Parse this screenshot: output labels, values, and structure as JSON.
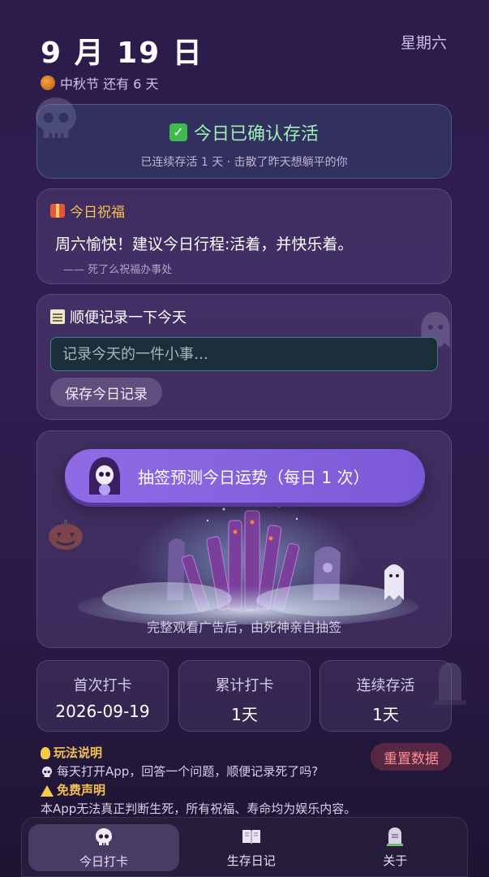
{
  "header": {
    "date": "9 月 19 日",
    "weekday": "星期六",
    "festival": "中秋节 还有 6 天"
  },
  "confirm": {
    "title": "今日已确认存活",
    "subtitle": "已连续存活 1 天 · 击散了昨天想躺平的你"
  },
  "blessing": {
    "heading": "今日祝福",
    "text": "周六愉快！建议今日行程:活着，并快乐着。",
    "signature": "—— 死了么祝福办事处"
  },
  "record": {
    "heading": "顺便记录一下今天",
    "placeholder": "记录今天的一件小事…",
    "save_label": "保存今日记录"
  },
  "fortune": {
    "button_label": "抽签预测今日运势（每日 1 次）",
    "caption": "完整观看广告后，由死神亲自抽签"
  },
  "stats": [
    {
      "label": "首次打卡",
      "value": "2026-09-19"
    },
    {
      "label": "累计打卡",
      "value": "1天"
    },
    {
      "label": "连续存活",
      "value": "1天"
    }
  ],
  "help": {
    "rules_title": "玩法说明",
    "rules_text": "每天打开App，回答一个问题，顺便记录死了吗?",
    "disclaimer_title": "免费声明",
    "disclaimer_text": "本App无法真正判断生死，所有祝福、寿命均为娱乐内容。",
    "reset_label": "重置数据"
  },
  "tabs": [
    {
      "label": "今日打卡",
      "icon": "skull-icon",
      "active": true
    },
    {
      "label": "生存日记",
      "icon": "book-icon",
      "active": false
    },
    {
      "label": "关于",
      "icon": "tombstone-icon",
      "active": false
    }
  ],
  "colors": {
    "accent": "#8f6be6",
    "confirm_green": "#9ff0b4",
    "gold": "#f5c153",
    "danger": "#ff8f8f"
  }
}
